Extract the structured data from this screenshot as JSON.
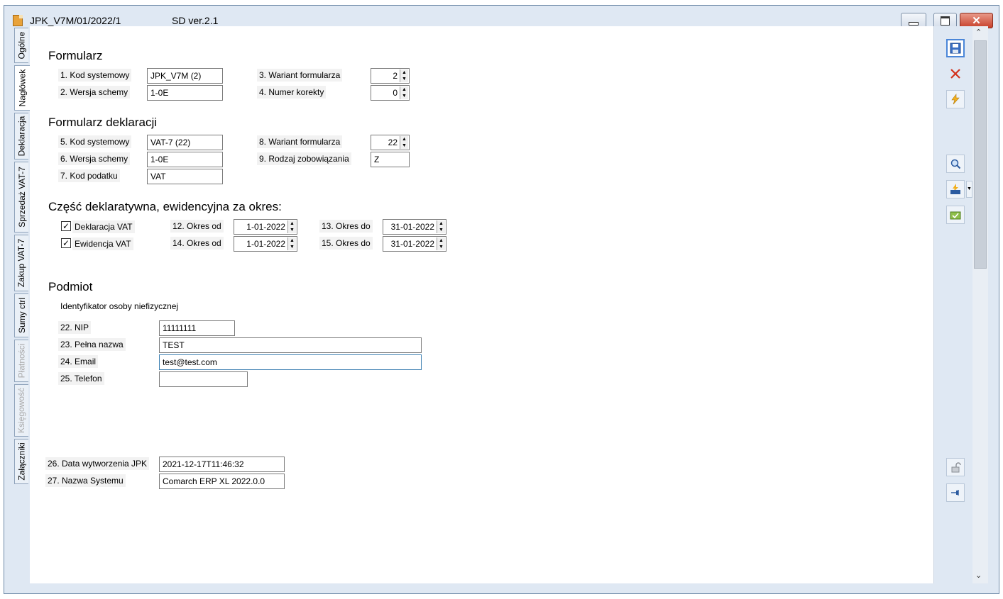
{
  "window": {
    "title": "JPK_V7M/01/2022/1",
    "version": "SD ver.2.1",
    "close_glyph": "✕"
  },
  "tabs": [
    {
      "label": "Ogólne"
    },
    {
      "label": "Nagłówek"
    },
    {
      "label": "Deklaracja"
    },
    {
      "label": "Sprzedaż VAT-7"
    },
    {
      "label": "Zakup VAT-7"
    },
    {
      "label": "Sumy ctrl"
    },
    {
      "label": "Płatności"
    },
    {
      "label": "Księgowość"
    },
    {
      "label": "Załączniki"
    }
  ],
  "formularz": {
    "heading": "Formularz",
    "kod_systemowy_label": "1. Kod systemowy",
    "kod_systemowy_value": "JPK_V7M (2)",
    "wersja_schemy_label": "2. Wersja schemy",
    "wersja_schemy_value": "1-0E",
    "wariant_label": "3. Wariant formularza",
    "wariant_value": "2",
    "numer_korekty_label": "4. Numer korekty",
    "numer_korekty_value": "0"
  },
  "deklaracja": {
    "heading": "Formularz deklaracji",
    "kod_systemowy_label": "5. Kod systemowy",
    "kod_systemowy_value": "VAT-7 (22)",
    "wersja_schemy_label": "6. Wersja schemy",
    "wersja_schemy_value": "1-0E",
    "kod_podatku_label": "7. Kod podatku",
    "kod_podatku_value": "VAT",
    "wariant_label": "8. Wariant formularza",
    "wariant_value": "22",
    "rodzaj_label": "9. Rodzaj zobowiązania",
    "rodzaj_value": "Z"
  },
  "okres": {
    "heading": "Część deklaratywna, ewidencyjna za okres:",
    "deklaracja_vat_label": "Deklaracja VAT",
    "ewidencja_vat_label": "Ewidencja VAT",
    "check_glyph": "✓",
    "okres_od_12_label": "12. Okres od",
    "okres_od_12_value": "1-01-2022",
    "okres_od_14_label": "14. Okres od",
    "okres_od_14_value": "1-01-2022",
    "okres_do_13_label": "13. Okres do",
    "okres_do_13_value": "31-01-2022",
    "okres_do_15_label": "15. Okres do",
    "okres_do_15_value": "31-01-2022"
  },
  "podmiot": {
    "heading": "Podmiot",
    "identyfikator_label": "Identyfikator osoby niefizycznej",
    "nip_label": "22. NIP",
    "nip_value": "11111111",
    "nazwa_label": "23. Pełna nazwa",
    "nazwa_value": "TEST",
    "email_label": "24. Email",
    "email_value": "test@test.com",
    "telefon_label": "25. Telefon",
    "telefon_value": ""
  },
  "system": {
    "data_label": "26. Data wytworzenia JPK",
    "data_value": "2021-12-17T11:46:32",
    "nazwa_label": "27. Nazwa Systemu",
    "nazwa_value": "Comarch ERP XL 2022.0.0"
  },
  "spin_glyphs": {
    "up": "▲",
    "down": "▼"
  },
  "scroll": {
    "up": "⌃",
    "down": "⌄"
  },
  "toolbar_icons": [
    "save-icon",
    "cancel-icon",
    "generate-icon",
    "preview-icon",
    "vat-icon",
    "export-icon",
    "unlock-icon",
    "pin-icon"
  ]
}
